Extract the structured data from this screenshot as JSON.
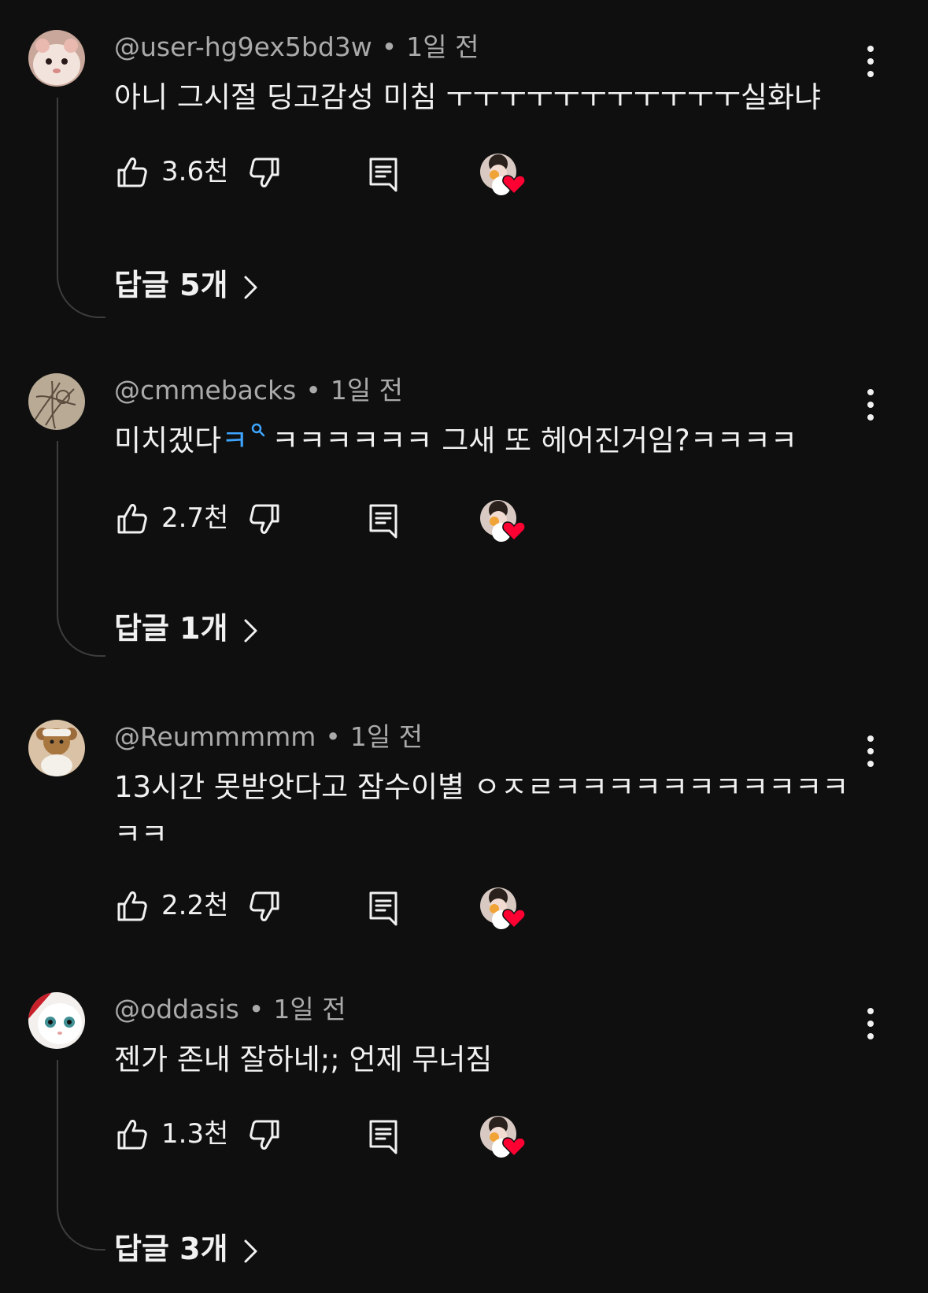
{
  "comments": [
    {
      "handle": "@user-hg9ex5bd3w",
      "time": "1일 전",
      "text": "아니 그시절 딩고감성 미침 ㅜㅜㅜㅜㅜㅜㅜㅜㅜㅜㅜ실화냐",
      "likes": "3.6천",
      "replies_label": "답글 5개",
      "avatar_icon": "hamster-avatar"
    },
    {
      "handle": "@cmmebacks",
      "time": "1일 전",
      "text_before": "미치겠다",
      "text_highlight": "ㅋ",
      "text_after": "ㅋㅋㅋㅋㅋㅋ 그새 또 헤어진거임?ㅋㅋㅋㅋ",
      "likes": "2.7천",
      "replies_label": "답글 1개",
      "avatar_icon": "sketch-avatar"
    },
    {
      "handle": "@Reummmmm",
      "time": "1일 전",
      "text": "13시간 못받앗다고 잠수이별 ㅇㅈㄹㅋㅋㅋㅋㅋㅋㅋㅋㅋㅋㅋㅋㅋ",
      "likes": "2.2천",
      "avatar_icon": "teddy-bear-avatar"
    },
    {
      "handle": "@oddasis",
      "time": "1일 전",
      "text": "젠가 존내 잘하네;; 언제 무너짐",
      "likes": "1.3천",
      "replies_label": "답글 3개",
      "avatar_icon": "white-cat-avatar"
    }
  ],
  "separator": "•",
  "colors": {
    "background": "#0f0f0f",
    "primary_text": "#f1f1f1",
    "secondary_text": "#aaaaaa",
    "link_blue": "#3ea6ff",
    "heart_red": "#ff0033"
  }
}
